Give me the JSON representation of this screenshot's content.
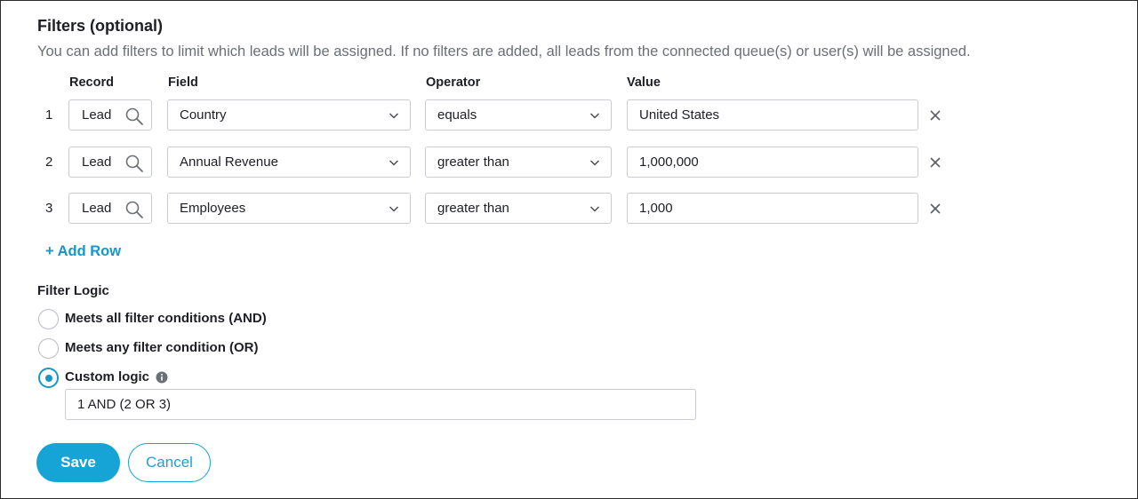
{
  "filters": {
    "title": "Filters (optional)",
    "description": "You can add filters to limit which leads will be assigned. If no filters are added, all leads from the connected queue(s) or user(s) will be assigned.",
    "columns": {
      "record": "Record",
      "field": "Field",
      "operator": "Operator",
      "value": "Value"
    },
    "rows": [
      {
        "num": "1",
        "record": "Lead",
        "field": "Country",
        "operator": "equals",
        "value": "United States"
      },
      {
        "num": "2",
        "record": "Lead",
        "field": "Annual Revenue",
        "operator": "greater than",
        "value": "1,000,000"
      },
      {
        "num": "3",
        "record": "Lead",
        "field": "Employees",
        "operator": "greater than",
        "value": "1,000"
      }
    ],
    "add_row_label": "+ Add Row"
  },
  "filter_logic": {
    "label": "Filter Logic",
    "options": [
      {
        "label": "Meets all filter conditions (AND)",
        "selected": false
      },
      {
        "label": "Meets any filter condition (OR)",
        "selected": false
      },
      {
        "label": "Custom logic",
        "selected": true
      }
    ],
    "custom_value": "1 AND (2 OR 3)"
  },
  "actions": {
    "save_label": "Save",
    "cancel_label": "Cancel"
  },
  "colors": {
    "accent": "#16a3d6",
    "text": "#1d1f24",
    "muted": "#6b6f76",
    "border": "#c9ccd1"
  },
  "icons": {
    "record_search": "search-icon",
    "dropdown": "chevron-down-icon",
    "remove_row": "close-icon",
    "info": "info-icon"
  }
}
